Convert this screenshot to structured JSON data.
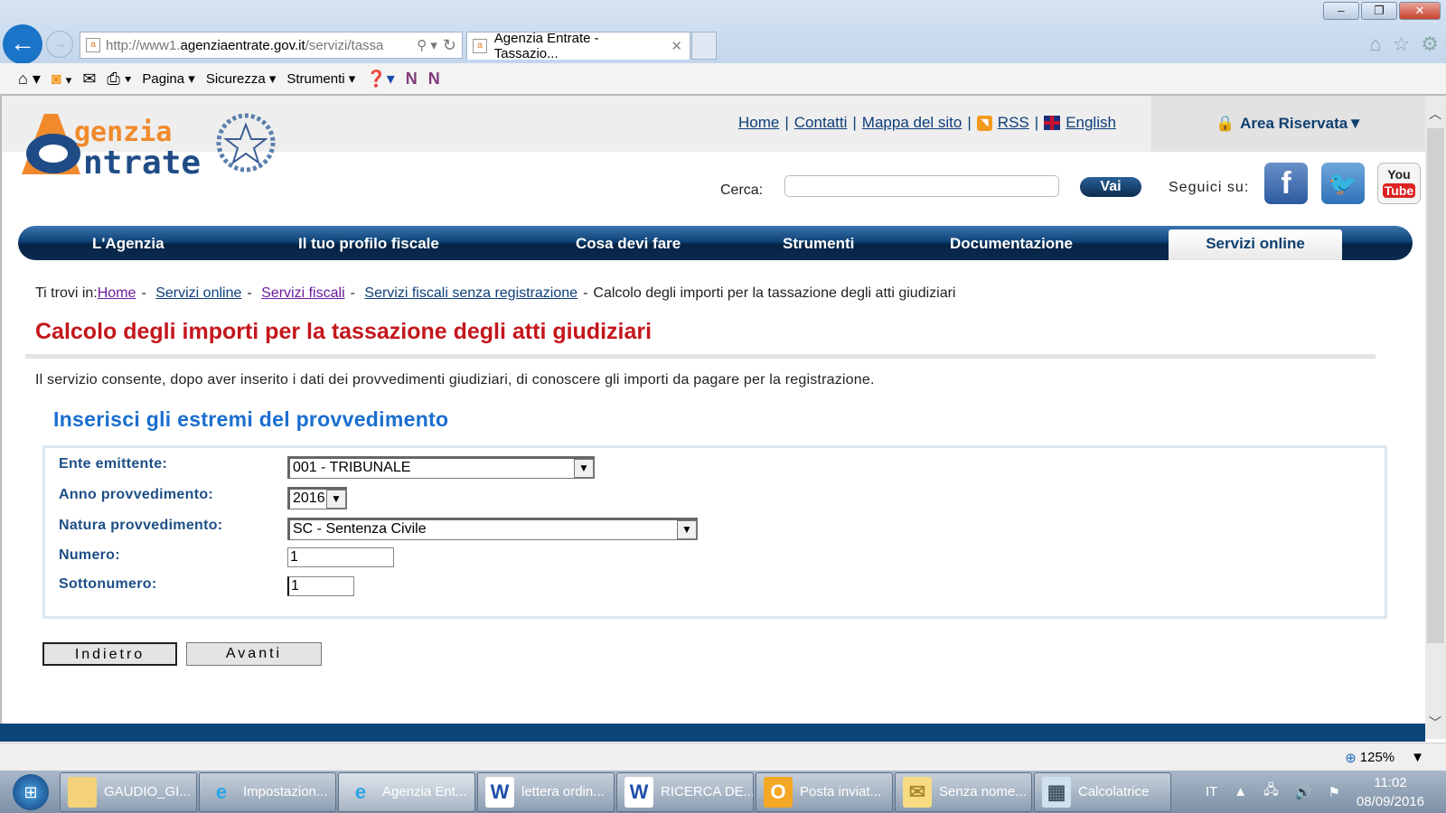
{
  "browser": {
    "url_prefix": "http://www1.",
    "url_domain": "agenziaentrate.gov.it",
    "url_path": "/servizi/tassa",
    "tab_title": "Agenzia Entrate - Tassazio...",
    "commands": [
      "Pagina",
      "Sicurezza",
      "Strumenti"
    ],
    "zoom": "125%"
  },
  "header": {
    "links": [
      "Home",
      "Contatti",
      "Mappa del sito",
      "RSS",
      "English"
    ],
    "area_riservata": "Area Riservata▼",
    "search_label": "Cerca:",
    "search_value": "",
    "search_button": "Vai",
    "follow_label": "Seguici su:",
    "logo_text": "Agenzia Entrate"
  },
  "nav": [
    "L'Agenzia",
    "Il tuo profilo fiscale",
    "Cosa devi fare",
    "Strumenti",
    "Documentazione",
    "Servizi online"
  ],
  "breadcrumb": {
    "prefix": "Ti trovi in:",
    "items": [
      "Home",
      "Servizi online",
      "Servizi fiscali",
      "Servizi fiscali senza registrazione"
    ],
    "current": "Calcolo degli importi per la tassazione degli atti giudiziari"
  },
  "page": {
    "title": "Calcolo degli importi per la tassazione degli atti giudiziari",
    "description": "Il servizio consente, dopo aver inserito i dati dei provvedimenti giudiziari, di conoscere gli importi da pagare per la registrazione.",
    "subtitle": "Inserisci gli estremi del provvedimento"
  },
  "form": {
    "ente_label": "Ente emittente:",
    "ente_value": "001 - TRIBUNALE",
    "anno_label": "Anno provvedimento:",
    "anno_value": "2016",
    "natura_label": "Natura provvedimento:",
    "natura_value": "SC - Sentenza Civile",
    "numero_label": "Numero:",
    "numero_value": "1",
    "sottonumero_label": "Sottonumero:",
    "sottonumero_value": "1",
    "back": "Indietro",
    "next": "Avanti"
  },
  "taskbar": {
    "items": [
      "GAUDIO_GI...",
      "Impostazion...",
      "Agenzia Ent...",
      "lettera ordin...",
      "RICERCA DE...",
      "Posta inviat...",
      "Senza nome...",
      "Calcolatrice"
    ],
    "lang": "IT",
    "time": "11:02",
    "date": "08/09/2016"
  },
  "colors": {
    "title_red": "#c4161c",
    "subtitle_blue": "#1a6ecf",
    "nav_blue": "#0f4377",
    "label_blue": "#1d4f86"
  }
}
